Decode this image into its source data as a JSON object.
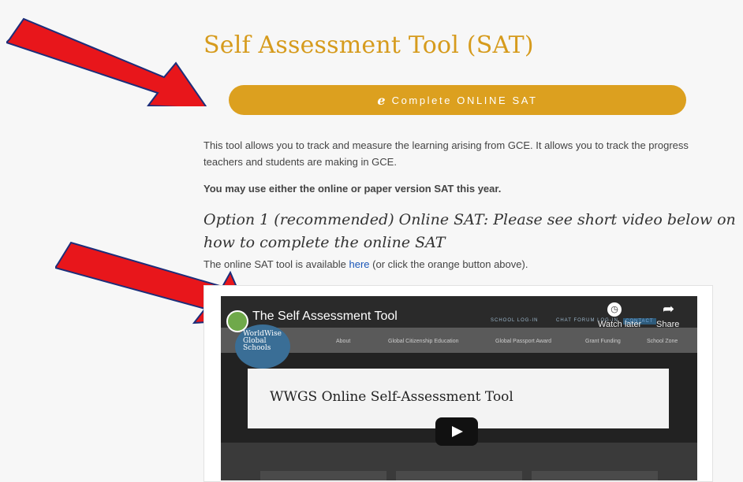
{
  "heading": {
    "title": "Self Assessment Tool (SAT)"
  },
  "cta": {
    "label": "Complete ONLINE SAT",
    "icon": "internet-explorer-icon",
    "color": "#dca01f"
  },
  "content": {
    "para1": "This tool allows you to track and measure the learning arising from GCE. It allows you to track the progress teachers and students are making in GCE.",
    "para2": "You may use either the online or paper version SAT this year.",
    "option_heading": "Option 1 (recommended) Online SAT: Please see short video below on how to complete the online SAT",
    "para3_before": "The online SAT tool is available ",
    "para3_link": "here",
    "para3_after": " (or click the orange button above)."
  },
  "video": {
    "title": "The Self Assessment Tool",
    "top_links": [
      "SCHOOL LOG-IN",
      "CHAT FORUM LOG-IN",
      "CONTACT"
    ],
    "watch_later": "Watch later",
    "share": "Share",
    "logo_text": [
      "WorldWise",
      "Global",
      "Schools"
    ],
    "menu": [
      "About",
      "Global Citizenship Education",
      "Global Passport Award",
      "Grant Funding",
      "School Zone"
    ],
    "card_title": "WWGS Online Self-Assessment Tool"
  },
  "colors": {
    "title": "#d69b1d",
    "link": "#1a56b8",
    "arrow": "#e8161b"
  }
}
